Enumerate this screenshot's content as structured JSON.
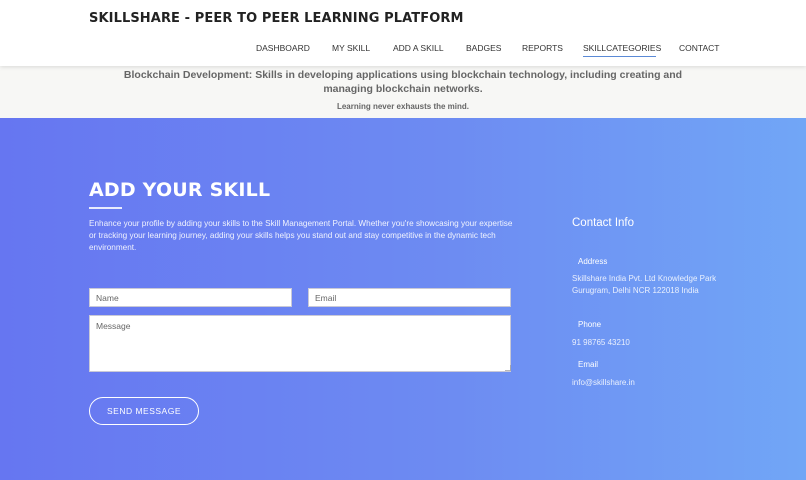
{
  "header": {
    "brand": "SKILLSHARE - PEER TO PEER LEARNING PLATFORM",
    "nav": [
      {
        "label": "DASHBOARD"
      },
      {
        "label": "MY SKILL"
      },
      {
        "label": "ADD A SKILL"
      },
      {
        "label": "BADGES"
      },
      {
        "label": "REPORTS"
      },
      {
        "label": "SKILLCATEGORIES",
        "active": true
      },
      {
        "label": "CONTACT"
      }
    ]
  },
  "banner": {
    "description": "Blockchain Development: Skills in developing applications using blockchain technology, including creating and managing blockchain networks.",
    "quote": "Learning never exhausts the mind."
  },
  "form": {
    "title": "ADD YOUR SKILL",
    "intro": "Enhance your profile by adding your skills to the Skill Management Portal. Whether you're showcasing your expertise or tracking your learning journey, adding your skills helps you stand out and stay competitive in the dynamic tech environment.",
    "name_placeholder": "Name",
    "email_placeholder": "Email",
    "message_placeholder": "Message",
    "send_label": "SEND MESSAGE"
  },
  "contact": {
    "title": "Contact Info",
    "address_label": "Address",
    "address_value": "Skillshare India Pvt. Ltd Knowledge Park Gurugram, Delhi NCR 122018 India",
    "phone_label": "Phone",
    "phone_value": "91 98765 43210",
    "email_label": "Email",
    "email_value": "info@skillshare.in"
  },
  "colors": {
    "gradient_start": "#6676f1",
    "gradient_end": "#71a6f6",
    "active_underline": "#5b8ad6"
  }
}
